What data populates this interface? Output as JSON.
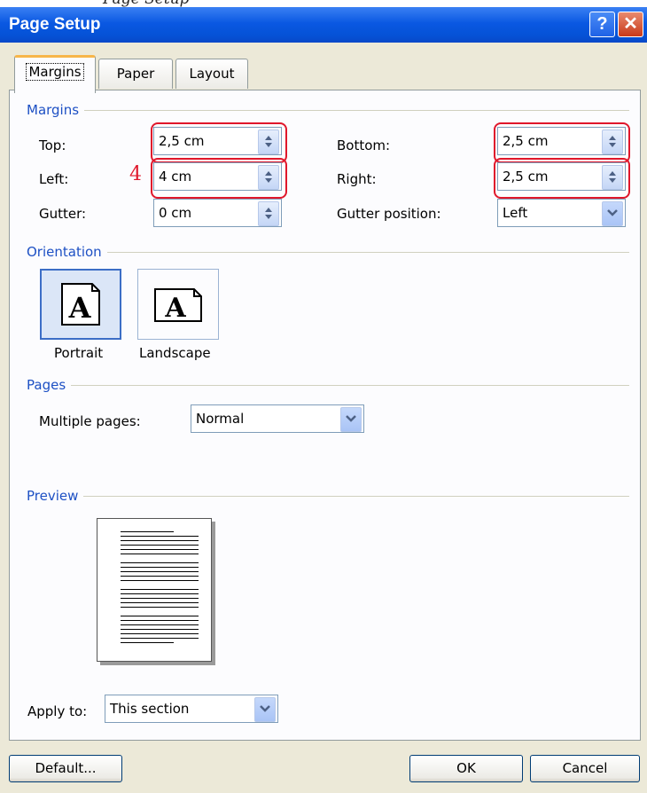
{
  "window": {
    "title": "Page Setup",
    "header_fragment": "Page Setup"
  },
  "tabs": [
    {
      "label": "Margins"
    },
    {
      "label": "Paper"
    },
    {
      "label": "Layout"
    }
  ],
  "margins": {
    "section": "Margins",
    "top_label": "Top:",
    "top_value": "2,5 cm",
    "bottom_label": "Bottom:",
    "bottom_value": "2,5 cm",
    "left_label": "Left:",
    "left_value": "4 cm",
    "right_label": "Right:",
    "right_value": "2,5 cm",
    "gutter_label": "Gutter:",
    "gutter_value": "0 cm",
    "gutter_position_label": "Gutter position:",
    "gutter_position_value": "Left",
    "annotation": "4"
  },
  "orientation": {
    "section": "Orientation",
    "portrait": "Portrait",
    "landscape": "Landscape",
    "selected": "Portrait"
  },
  "pages": {
    "section": "Pages",
    "multiple_label": "Multiple pages:",
    "multiple_value": "Normal"
  },
  "preview": {
    "section": "Preview"
  },
  "apply": {
    "label": "Apply to:",
    "value": "This section"
  },
  "buttons": {
    "default": "Default...",
    "ok": "OK",
    "cancel": "Cancel"
  },
  "colors": {
    "titlebar": "#0a58e2",
    "section_label": "#1d50c4",
    "highlight": "#e0172b",
    "dialog_bg": "#ece9d8"
  },
  "icons": {
    "help": "help-icon",
    "close": "close-icon",
    "spinner": "spinner-arrows-icon",
    "dropdown": "chevron-down-icon"
  }
}
